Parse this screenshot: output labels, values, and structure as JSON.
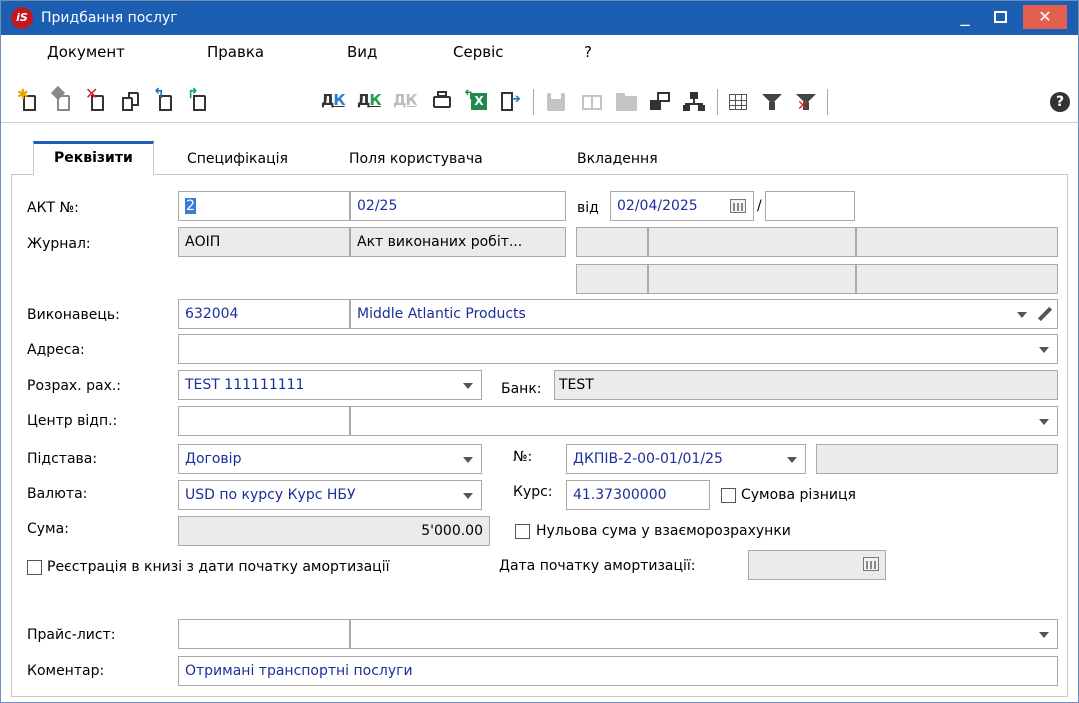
{
  "window": {
    "title": "Придбання послуг"
  },
  "menu": [
    "Документ",
    "Правка",
    "Вид",
    "Сервіс",
    "?"
  ],
  "toolbar": {
    "icons": [
      "new-doc-icon",
      "edit-doc-icon",
      "delete-doc-icon",
      "copy-doc-icon",
      "doc-arrow-blue-icon",
      "doc-arrow-teal-icon",
      "dk-blue-icon",
      "dk-green-icon",
      "dk-gray-icon",
      "print-icon",
      "excel-export-icon",
      "exit-icon",
      "save-icon",
      "book-icon",
      "folder-icon",
      "chat-icon",
      "hierarchy-icon",
      "grid-icon",
      "filter-icon",
      "clear-filter-icon",
      "help-icon"
    ]
  },
  "tabs": [
    "Реквізити",
    "Специфікація",
    "Поля користувача",
    "Вкладення"
  ],
  "form": {
    "act_label": "АКТ №:",
    "act_number": "2",
    "act_suffix": "02/25",
    "from_label": "від",
    "date": "02/04/2025",
    "slash": "/",
    "journal_label": "Журнал:",
    "journal_code": "АОІП",
    "journal_name": "Акт виконаних робіт...",
    "contractor_label": "Виконавець:",
    "contractor_code": "632004",
    "contractor_name": "Middle Atlantic Products",
    "address_label": "Адреса:",
    "account_label": "Розрах. рах.:",
    "account_value": "TEST 111111111",
    "bank_label": "Банк:",
    "bank_value": "TEST",
    "center_label": "Центр відп.:",
    "basis_label": "Підстава:",
    "basis_value": "Договір",
    "number_label": "№:",
    "number_value": "ДКПІВ-2-00-01/01/25",
    "currency_label": "Валюта:",
    "currency_value": "USD по курсу Курс НБУ",
    "rate_label": "Курс:",
    "rate_value": "41.37300000",
    "sum_diff_label": "Сумова різниця",
    "sum_label": "Сума:",
    "sum_value": "5'000.00",
    "zero_sum_label": "Нульова сума у взаєморозрахунки",
    "register_label": "Реєстрація в книзі з дати початку амортизації",
    "amort_date_label": "Дата початку амортизації:",
    "pricelist_label": "Прайс-лист:",
    "comment_label": "Коментар:",
    "comment_value": "Отримані транспортні послуги"
  },
  "colors": {
    "titlebar": "#1c5fb2",
    "close": "#e35f50",
    "value_text": "#1c2f9a",
    "readonly_bg": "#ebebeb"
  }
}
